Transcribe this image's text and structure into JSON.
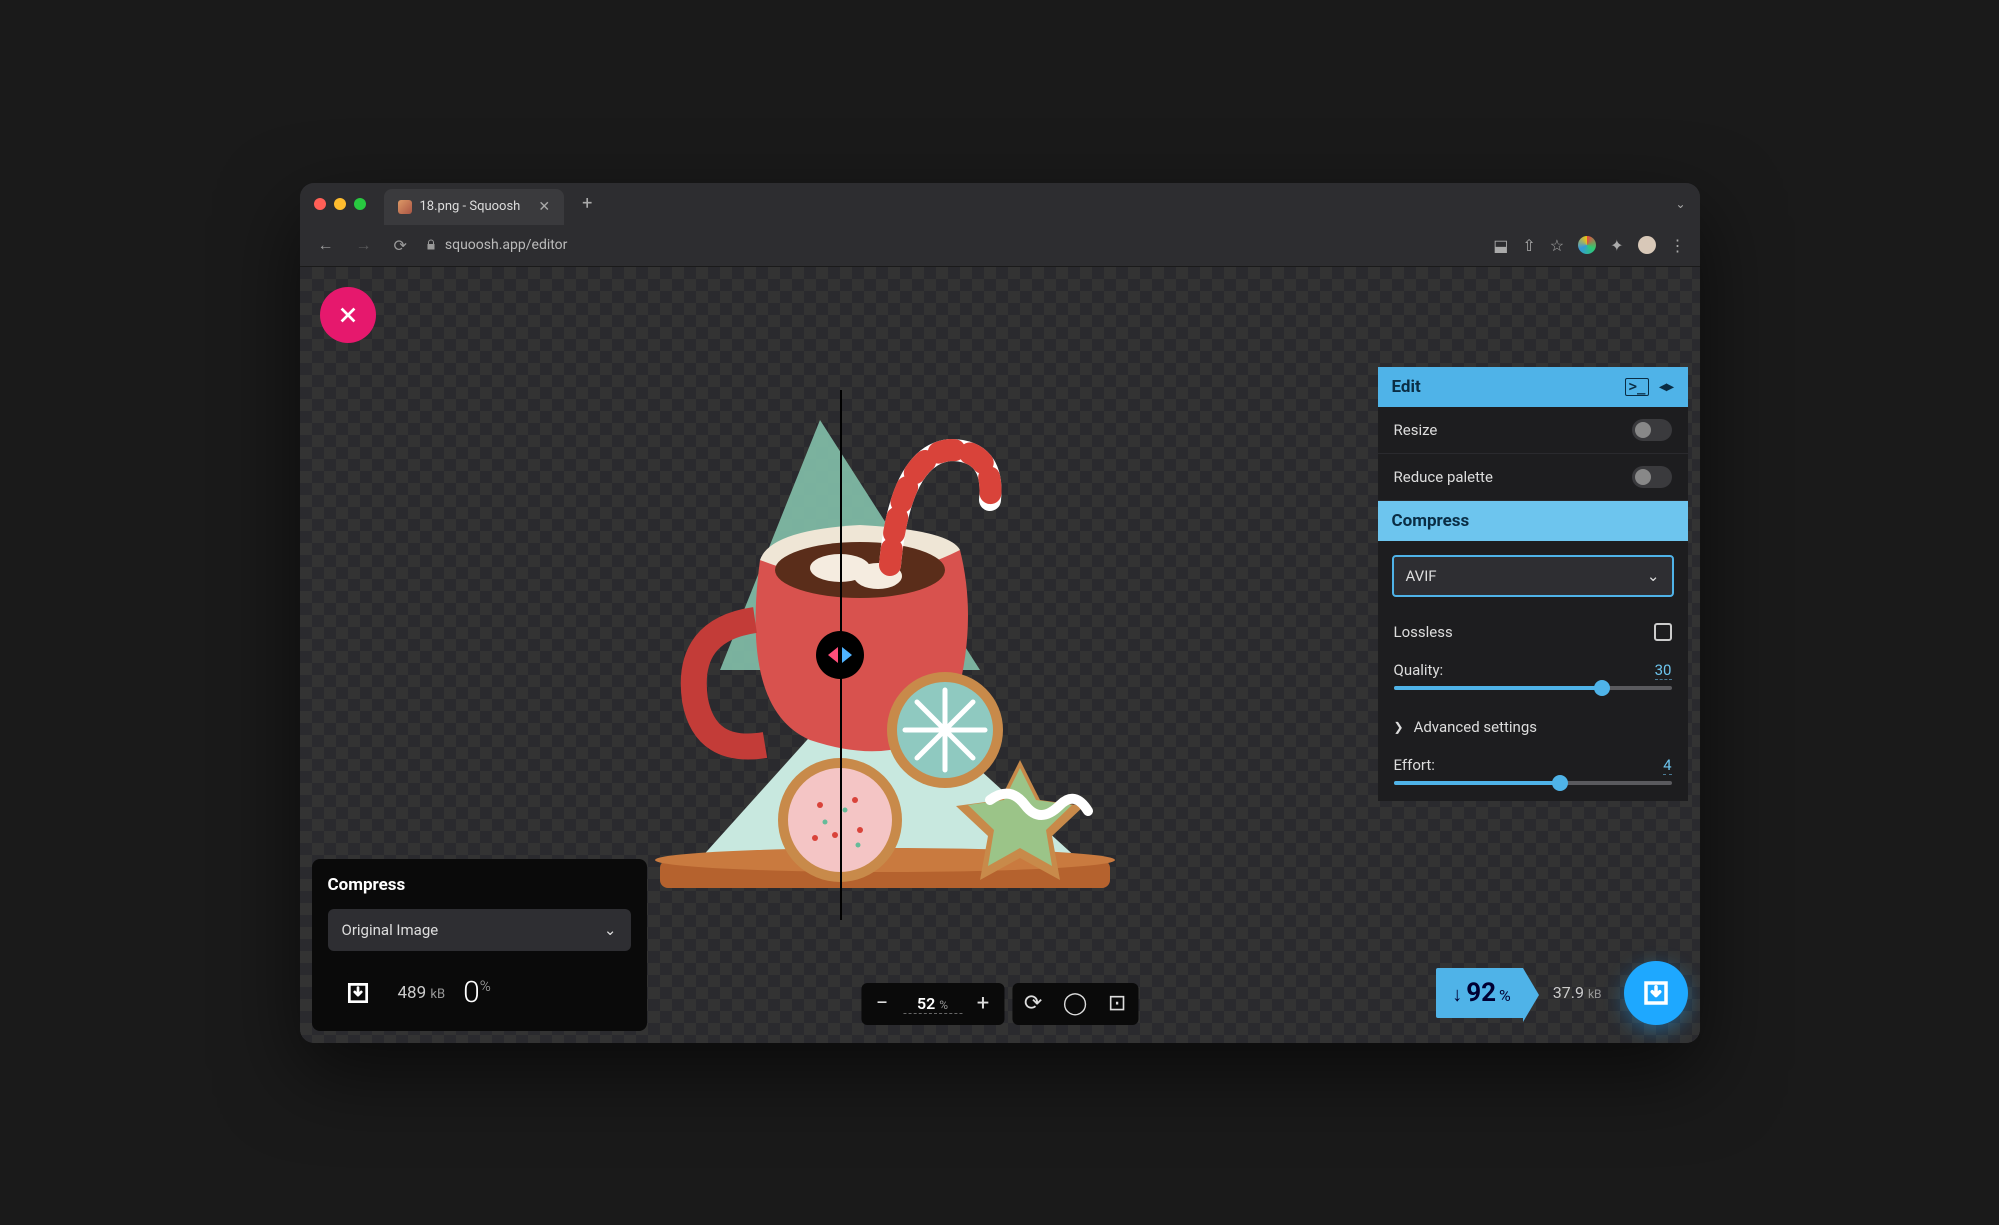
{
  "browser": {
    "tab_title": "18.png - Squoosh",
    "url": "squoosh.app/editor"
  },
  "left_panel": {
    "title": "Compress",
    "format_selected": "Original Image",
    "file_size_value": "489",
    "file_size_unit": "kB",
    "savings_percent": "0",
    "savings_unit": "%"
  },
  "right_panel": {
    "edit_title": "Edit",
    "resize_label": "Resize",
    "resize_on": false,
    "reduce_palette_label": "Reduce palette",
    "reduce_palette_on": false,
    "compress_title": "Compress",
    "format_selected": "AVIF",
    "lossless_label": "Lossless",
    "lossless_on": false,
    "quality_label": "Quality:",
    "quality_value": "30",
    "quality_pct": 75,
    "advanced_label": "Advanced settings",
    "effort_label": "Effort:",
    "effort_value": "4",
    "effort_pct": 60
  },
  "right_footer": {
    "savings_percent": "92",
    "savings_unit": "%",
    "file_size_value": "37.9",
    "file_size_unit": "kB"
  },
  "zoom": {
    "value": "52",
    "unit": "%"
  }
}
